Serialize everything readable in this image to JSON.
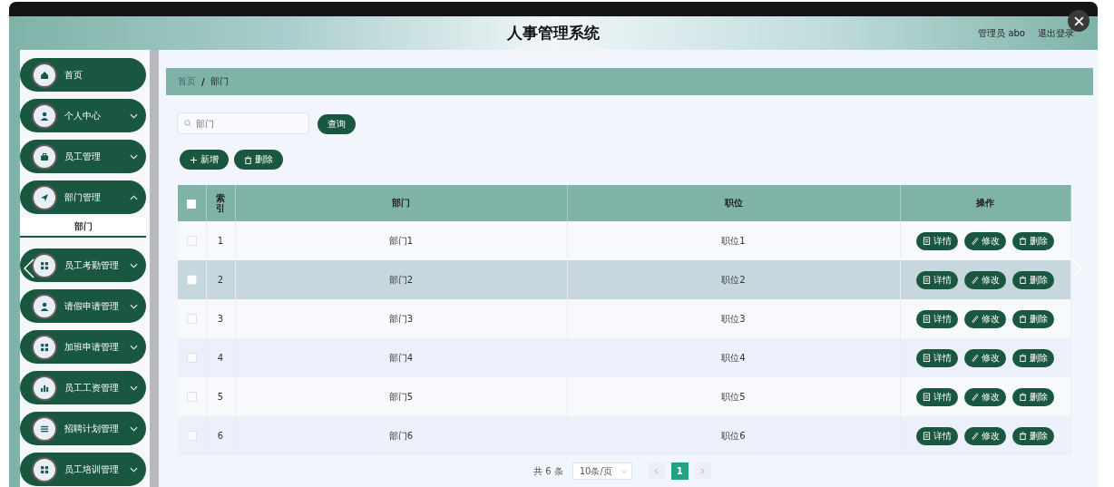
{
  "header": {
    "title": "人事管理系统",
    "user": "管理员 abo",
    "logout": "退出登录"
  },
  "sidebar": {
    "items": [
      {
        "label": "首页",
        "kind": "link"
      },
      {
        "label": "个人中心",
        "kind": "menu",
        "expanded": false
      },
      {
        "label": "员工管理",
        "kind": "menu",
        "expanded": false
      },
      {
        "label": "部门管理",
        "kind": "menu",
        "expanded": true,
        "children": [
          {
            "label": "部门",
            "selected": true
          }
        ]
      },
      {
        "label": "员工考勤管理",
        "kind": "menu",
        "expanded": false
      },
      {
        "label": "请假申请管理",
        "kind": "menu",
        "expanded": false
      },
      {
        "label": "加班申请管理",
        "kind": "menu",
        "expanded": false
      },
      {
        "label": "员工工资管理",
        "kind": "menu",
        "expanded": false
      },
      {
        "label": "招聘计划管理",
        "kind": "menu",
        "expanded": false
      },
      {
        "label": "员工培训管理",
        "kind": "menu",
        "expanded": false
      }
    ]
  },
  "breadcrumb": {
    "items": [
      "首页",
      "部门"
    ],
    "separator": "/"
  },
  "search": {
    "placeholder": "部门",
    "button": "查询"
  },
  "actions": [
    "新增",
    "删除"
  ],
  "table": {
    "select_all_checked": false,
    "columns": [
      "索引",
      "部门",
      "职位",
      "操作"
    ],
    "rows": [
      {
        "index": "1",
        "dept": "部门1",
        "position": "职位1",
        "checked": false,
        "highlighted": false,
        "buttons": [
          "详情",
          "修改",
          "删除"
        ]
      },
      {
        "index": "2",
        "dept": "部门2",
        "position": "职位2",
        "checked": false,
        "highlighted": true,
        "buttons": [
          "详情",
          "修改",
          "删除"
        ]
      },
      {
        "index": "3",
        "dept": "部门3",
        "position": "职位3",
        "checked": false,
        "highlighted": false,
        "buttons": [
          "详情",
          "修改",
          "删除"
        ]
      },
      {
        "index": "4",
        "dept": "部门4",
        "position": "职位4",
        "checked": false,
        "highlighted": false,
        "buttons": [
          "详情",
          "修改",
          "删除"
        ]
      },
      {
        "index": "5",
        "dept": "部门5",
        "position": "职位5",
        "checked": false,
        "highlighted": false,
        "buttons": [
          "详情",
          "修改",
          "删除"
        ]
      },
      {
        "index": "6",
        "dept": "部门6",
        "position": "职位6",
        "checked": false,
        "highlighted": false,
        "buttons": [
          "详情",
          "修改",
          "删除"
        ]
      }
    ]
  },
  "pagination": {
    "total": "共 6 条",
    "page_size": "10条/页",
    "pages": [
      {
        "label": "1",
        "selected": true
      }
    ]
  }
}
